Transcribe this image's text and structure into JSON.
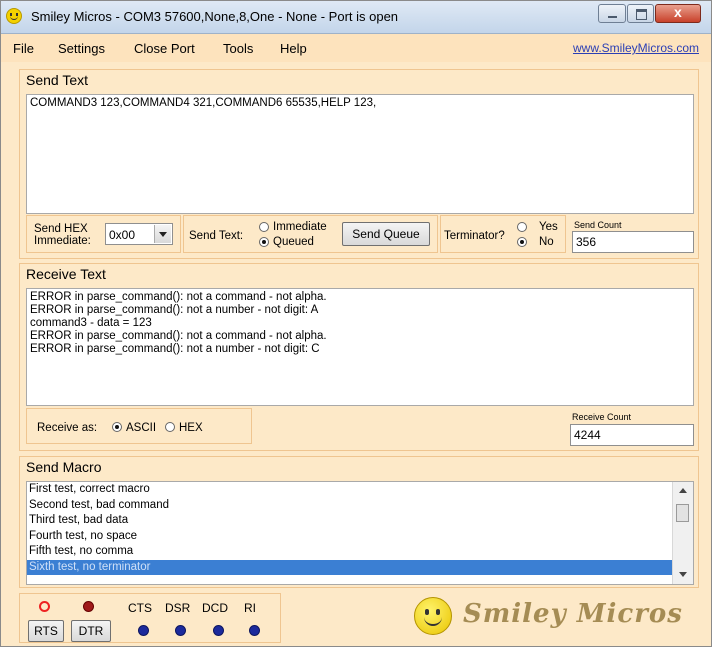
{
  "window": {
    "title": "Smiley Micros - COM3 57600,None,8,One - None - Port is open"
  },
  "menu": {
    "items": [
      "File",
      "Settings",
      "Close Port",
      "Tools",
      "Help"
    ],
    "link": "www.SmileyMicros.com"
  },
  "send_text": {
    "title": "Send Text",
    "content": "COMMAND3 123,COMMAND4 321,COMMAND6 65535,HELP 123,",
    "hex_label_1": "Send HEX",
    "hex_label_2": "Immediate:",
    "hex_value": "0x00",
    "send_mode_label": "Send Text:",
    "immediate_label": "Immediate",
    "queued_label": "Queued",
    "send_queue_label": "Send Queue",
    "terminator_label": "Terminator?",
    "yes_label": "Yes",
    "no_label": "No",
    "send_count_label": "Send Count",
    "send_count": "356"
  },
  "receive_text": {
    "title": "Receive Text",
    "lines": [
      "ERROR in parse_command(): not a command - not alpha.",
      "ERROR in parse_command(): not a number - not digit: A",
      "command3 - data = 123",
      "ERROR in parse_command(): not a command - not alpha.",
      "ERROR in parse_command(): not a number - not digit: C"
    ],
    "receive_as_label": "Receive as:",
    "ascii_label": "ASCII",
    "hex_label": "HEX",
    "receive_count_label": "Receive Count",
    "receive_count": "4244"
  },
  "send_macro": {
    "title": "Send Macro",
    "items": [
      "First test, correct macro",
      "Second test, bad command",
      "Third test, bad data",
      "Fourth test, no space",
      "Fifth test, no comma",
      "Sixth test, no terminator"
    ],
    "selected_index": 5
  },
  "status": {
    "rts_label": "RTS",
    "dtr_label": "DTR",
    "cts_label": "CTS",
    "dsr_label": "DSR",
    "dcd_label": "DCD",
    "ri_label": "RI"
  },
  "logo": {
    "text": "Smiley Micros"
  },
  "colors": {
    "background": "#fde9c8",
    "selection": "#3b7fd3",
    "link": "#2b3fb5",
    "led_blue": "#1c2a9c"
  }
}
